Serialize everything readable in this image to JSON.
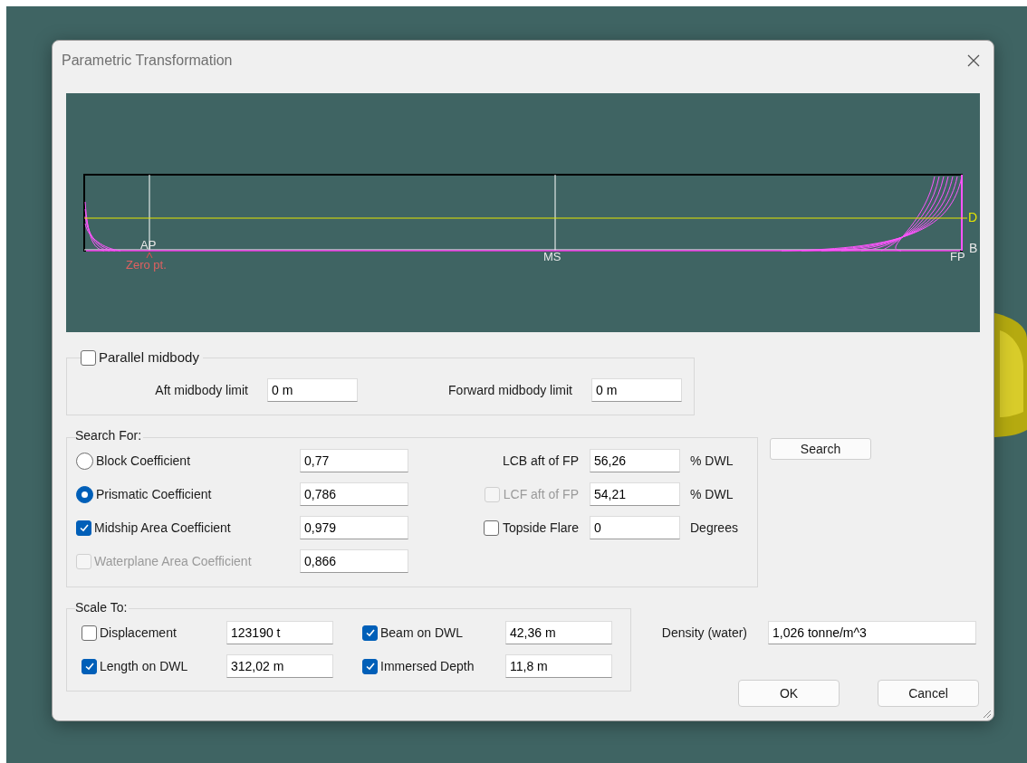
{
  "window": {
    "title": "Parametric Transformation"
  },
  "view": {
    "aft_perpendicular": "AP",
    "zero_point": "Zero pt.",
    "midship": "MS",
    "forward_perpendicular": "FP",
    "waterline_label": "D",
    "baseline_label": "B"
  },
  "parallel_midbody": {
    "label": "Parallel midbody",
    "checked": false,
    "fields": [
      {
        "label": "Aft midbody limit",
        "value": "0 m"
      },
      {
        "label": "Forward midbody limit",
        "value": "0 m"
      }
    ]
  },
  "search_for": {
    "title": "Search For:",
    "left": [
      {
        "kind": "radio",
        "label": "Block Coefficient",
        "selected": false,
        "value": "0,77"
      },
      {
        "kind": "radio",
        "label": "Prismatic Coefficient",
        "selected": true,
        "value": "0,786"
      },
      {
        "kind": "checkbox",
        "label": "Midship Area Coefficient",
        "checked": true,
        "disabled": false,
        "value": "0,979"
      },
      {
        "kind": "checkbox",
        "label": "Waterplane Area Coefficient",
        "checked": false,
        "disabled": true,
        "value": "0,866"
      }
    ],
    "right": [
      {
        "kind": "plain",
        "label": "LCB aft of FP",
        "value": "56,26",
        "unit": "% DWL"
      },
      {
        "kind": "checkbox",
        "label": "LCF aft of FP",
        "checked": false,
        "disabled": true,
        "value": "54,21",
        "unit": "% DWL"
      },
      {
        "kind": "checkbox",
        "label": "Topside Flare",
        "checked": false,
        "disabled": false,
        "value": "0",
        "unit": "Degrees"
      }
    ]
  },
  "search_button": "Search",
  "scale_to": {
    "title": "Scale To:",
    "items": [
      {
        "label": "Displacement",
        "checked": false,
        "value": "123190 t"
      },
      {
        "label": "Beam on DWL",
        "checked": true,
        "value": "42,36 m"
      },
      {
        "label": "Length on DWL",
        "checked": true,
        "value": "312,02 m"
      },
      {
        "label": "Immersed Depth",
        "checked": true,
        "value": "11,8 m"
      }
    ]
  },
  "density": {
    "label": "Density (water)",
    "value": "1,026 tonne/m^3"
  },
  "buttons": [
    "OK",
    "Cancel"
  ]
}
